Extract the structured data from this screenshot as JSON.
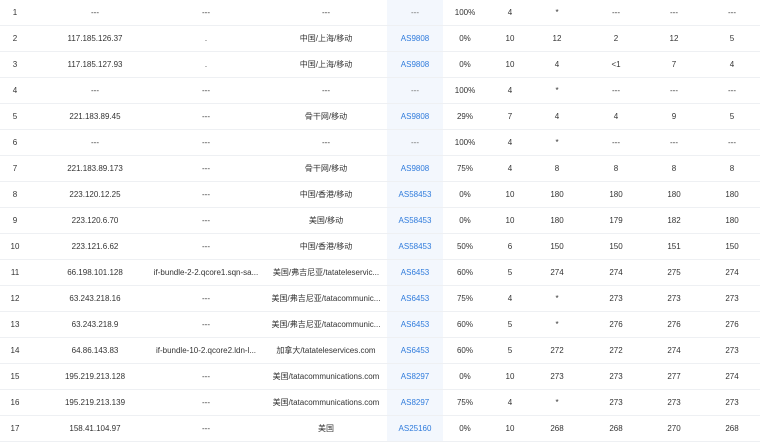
{
  "rows": [
    {
      "hop": "1",
      "ip": "---",
      "host": "---",
      "loc": "---",
      "as": "---",
      "loss": "100%",
      "snt": "4",
      "last": "*",
      "avg": "---",
      "best": "---",
      "worst": "---"
    },
    {
      "hop": "2",
      "ip": "117.185.126.37",
      "host": ".",
      "loc": "中国/上海/移动",
      "as": "AS9808",
      "loss": "0%",
      "snt": "10",
      "last": "12",
      "avg": "2",
      "best": "12",
      "worst": "5"
    },
    {
      "hop": "3",
      "ip": "117.185.127.93",
      "host": ".",
      "loc": "中国/上海/移动",
      "as": "AS9808",
      "loss": "0%",
      "snt": "10",
      "last": "4",
      "avg": "<1",
      "best": "7",
      "worst": "4"
    },
    {
      "hop": "4",
      "ip": "---",
      "host": "---",
      "loc": "---",
      "as": "---",
      "loss": "100%",
      "snt": "4",
      "last": "*",
      "avg": "---",
      "best": "---",
      "worst": "---"
    },
    {
      "hop": "5",
      "ip": "221.183.89.45",
      "host": "---",
      "loc": "骨干网/移动",
      "as": "AS9808",
      "loss": "29%",
      "snt": "7",
      "last": "4",
      "avg": "4",
      "best": "9",
      "worst": "5"
    },
    {
      "hop": "6",
      "ip": "---",
      "host": "---",
      "loc": "---",
      "as": "---",
      "loss": "100%",
      "snt": "4",
      "last": "*",
      "avg": "---",
      "best": "---",
      "worst": "---"
    },
    {
      "hop": "7",
      "ip": "221.183.89.173",
      "host": "---",
      "loc": "骨干网/移动",
      "as": "AS9808",
      "loss": "75%",
      "snt": "4",
      "last": "8",
      "avg": "8",
      "best": "8",
      "worst": "8"
    },
    {
      "hop": "8",
      "ip": "223.120.12.25",
      "host": "---",
      "loc": "中国/香港/移动",
      "as": "AS58453",
      "loss": "0%",
      "snt": "10",
      "last": "180",
      "avg": "180",
      "best": "180",
      "worst": "180"
    },
    {
      "hop": "9",
      "ip": "223.120.6.70",
      "host": "---",
      "loc": "美国/移动",
      "as": "AS58453",
      "loss": "0%",
      "snt": "10",
      "last": "180",
      "avg": "179",
      "best": "182",
      "worst": "180"
    },
    {
      "hop": "10",
      "ip": "223.121.6.62",
      "host": "---",
      "loc": "中国/香港/移动",
      "as": "AS58453",
      "loss": "50%",
      "snt": "6",
      "last": "150",
      "avg": "150",
      "best": "151",
      "worst": "150"
    },
    {
      "hop": "11",
      "ip": "66.198.101.128",
      "host": "if-bundle-2-2.qcore1.sqn-sa...",
      "loc": "美国/弗吉尼亚/tatateleservic...",
      "as": "AS6453",
      "loss": "60%",
      "snt": "5",
      "last": "274",
      "avg": "274",
      "best": "275",
      "worst": "274"
    },
    {
      "hop": "12",
      "ip": "63.243.218.16",
      "host": "---",
      "loc": "美国/弗吉尼亚/tatacommunic...",
      "as": "AS6453",
      "loss": "75%",
      "snt": "4",
      "last": "*",
      "avg": "273",
      "best": "273",
      "worst": "273"
    },
    {
      "hop": "13",
      "ip": "63.243.218.9",
      "host": "---",
      "loc": "美国/弗吉尼亚/tatacommunic...",
      "as": "AS6453",
      "loss": "60%",
      "snt": "5",
      "last": "*",
      "avg": "276",
      "best": "276",
      "worst": "276"
    },
    {
      "hop": "14",
      "ip": "64.86.143.83",
      "host": "if-bundle-10-2.qcore2.ldn-l...",
      "loc": "加拿大/tatateleservices.com",
      "as": "AS6453",
      "loss": "60%",
      "snt": "5",
      "last": "272",
      "avg": "272",
      "best": "274",
      "worst": "273"
    },
    {
      "hop": "15",
      "ip": "195.219.213.128",
      "host": "---",
      "loc": "美国/tatacommunications.com",
      "as": "AS8297",
      "loss": "0%",
      "snt": "10",
      "last": "273",
      "avg": "273",
      "best": "277",
      "worst": "274"
    },
    {
      "hop": "16",
      "ip": "195.219.213.139",
      "host": "---",
      "loc": "美国/tatacommunications.com",
      "as": "AS8297",
      "loss": "75%",
      "snt": "4",
      "last": "*",
      "avg": "273",
      "best": "273",
      "worst": "273"
    },
    {
      "hop": "17",
      "ip": "158.41.104.97",
      "host": "---",
      "loc": "美国",
      "as": "AS25160",
      "loss": "0%",
      "snt": "10",
      "last": "268",
      "avg": "268",
      "best": "270",
      "worst": "268"
    }
  ]
}
